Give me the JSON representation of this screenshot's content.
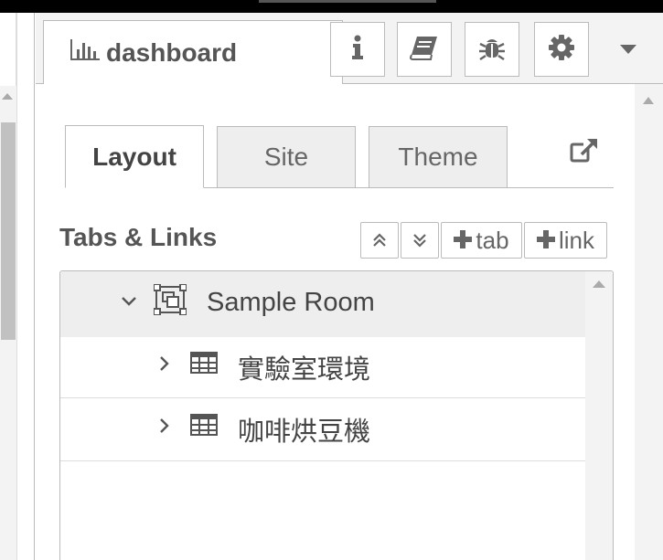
{
  "header": {
    "title": "dashboard",
    "title_icon": "bar-chart-icon",
    "buttons": [
      {
        "name": "info",
        "icon": "info-icon"
      },
      {
        "name": "help",
        "icon": "book-icon"
      },
      {
        "name": "debug",
        "icon": "bug-icon"
      },
      {
        "name": "config",
        "icon": "gear-icon"
      },
      {
        "name": "menu",
        "icon": "caret-down-icon"
      }
    ]
  },
  "tabs": [
    {
      "label": "Layout",
      "active": true
    },
    {
      "label": "Site",
      "active": false
    },
    {
      "label": "Theme",
      "active": false
    }
  ],
  "external_link_icon": "external-link-icon",
  "section": {
    "title": "Tabs & Links",
    "tools": {
      "collapse_icon": "double-chevron-up-icon",
      "expand_icon": "double-chevron-down-icon",
      "add_tab": "tab",
      "add_link": "link"
    }
  },
  "tree": {
    "group": {
      "label": "Sample Room",
      "expanded": true,
      "icon": "group-frame-icon"
    },
    "items": [
      {
        "label": "實驗室環境",
        "icon": "table-icon",
        "expanded": false
      },
      {
        "label": "咖啡烘豆機",
        "icon": "table-icon",
        "expanded": false
      }
    ]
  },
  "colors": {
    "accent_text": "#555555",
    "panel_bg": "#f3f3f3",
    "border": "#bbbbbb"
  }
}
